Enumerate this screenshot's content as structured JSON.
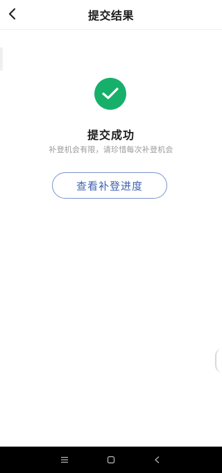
{
  "header": {
    "title": "提交结果"
  },
  "result": {
    "title": "提交成功",
    "description": "补登机会有限，请珍惜每次补登机会",
    "button_label": "查看补登进度"
  },
  "colors": {
    "success_green": "#17b06b",
    "button_border": "#7a93c9",
    "button_text": "#3e62b0",
    "nav_bg": "#000000"
  },
  "icons": {
    "back": "chevron-left-icon",
    "success": "check-circle-icon",
    "nav_menu": "menu-icon",
    "nav_home": "square-icon",
    "nav_back": "triangle-back-icon"
  }
}
